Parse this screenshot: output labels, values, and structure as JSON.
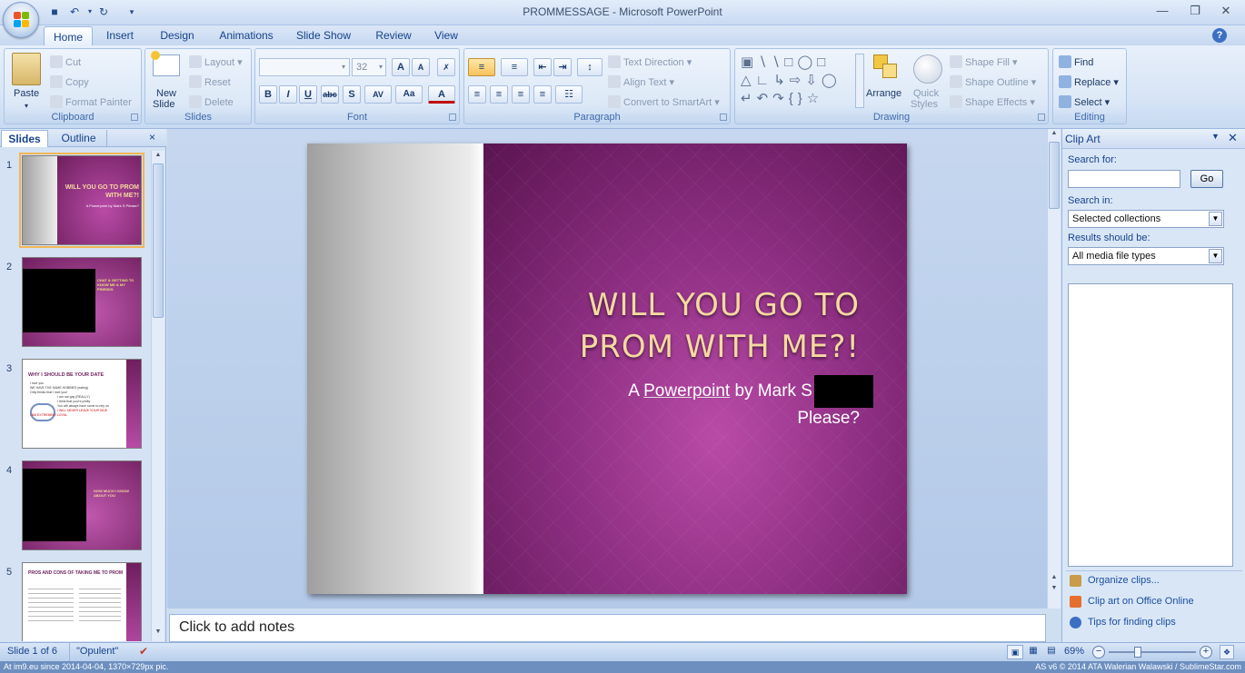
{
  "window": {
    "title": "PROMMESSAGE - Microsoft PowerPoint"
  },
  "tabs": [
    "Home",
    "Insert",
    "Design",
    "Animations",
    "Slide Show",
    "Review",
    "View"
  ],
  "ribbon": {
    "clipboard": {
      "label": "Clipboard",
      "paste": "Paste",
      "cut": "Cut",
      "copy": "Copy",
      "format_painter": "Format Painter"
    },
    "slides": {
      "label": "Slides",
      "new_slide_1": "New",
      "new_slide_2": "Slide",
      "layout": "Layout",
      "reset": "Reset",
      "delete": "Delete"
    },
    "font": {
      "label": "Font",
      "size": "32"
    },
    "paragraph": {
      "label": "Paragraph",
      "text_direction": "Text Direction",
      "align_text": "Align Text",
      "convert": "Convert to SmartArt"
    },
    "drawing": {
      "label": "Drawing",
      "arrange": "Arrange",
      "quick_styles_1": "Quick",
      "quick_styles_2": "Styles",
      "shape_fill": "Shape Fill",
      "shape_outline": "Shape Outline",
      "shape_effects": "Shape Effects"
    },
    "editing": {
      "label": "Editing",
      "find": "Find",
      "replace": "Replace",
      "select": "Select"
    }
  },
  "left_pane": {
    "tabs": [
      "Slides",
      "Outline"
    ],
    "slides": [
      {
        "num": "1",
        "title": "WILL YOU GO TO PROM WITH ME?!",
        "sub": "A Powerpoint by Mark S Please?"
      },
      {
        "num": "2",
        "title": "CHAT & GETTING TO KNOW ME & MY FRIENDS"
      },
      {
        "num": "3",
        "title": "WHY I SHOULD BE YOUR DATE",
        "lines": [
          "I love you",
          "WE HAVE THE SAME HOBBIES (eating)",
          "Only thinks that I love you!",
          "I am not gay (REALLY)",
          "I think that you're pretty",
          "You will always have some to rely on",
          "I WILL NEVER LEAVE YOUR SIDE",
          "I AM EXTREMELY LOYAL"
        ]
      },
      {
        "num": "4",
        "title": "HOW MUCH I KNOW ABOUT YOU"
      },
      {
        "num": "5",
        "title": "PROS AND CONS OF TAKING ME TO PROM"
      }
    ]
  },
  "slide": {
    "title_line1": "WILL YOU GO TO",
    "title_line2": "PROM WITH ME?!",
    "sub_prefix": "A ",
    "sub_link": "Powerpoint",
    "sub_suffix": " by Mark S",
    "sub_line2": "Please?"
  },
  "notes_placeholder": "Click to add notes",
  "clip_art": {
    "title": "Clip Art",
    "search_for_label": "Search for:",
    "search_value": "",
    "go": "Go",
    "search_in_label": "Search in:",
    "search_in_value": "Selected collections",
    "results_label": "Results should be:",
    "results_value": "All media file types",
    "links": [
      "Organize clips...",
      "Clip art on Office Online",
      "Tips for finding clips"
    ]
  },
  "status": {
    "slide_info": "Slide 1 of 6",
    "theme": "\"Opulent\"",
    "zoom": "69%"
  },
  "watermark": {
    "left": "At im9.eu  since 2014-04-04, 1370×729px pic.",
    "right": "AS v6 © 2014 ATA Walerian Walawski / SublimeStar.com"
  },
  "colors": {
    "ribbon": "#dbe7f7",
    "slide_purple": "#8e2f83",
    "title_gold": "#f5d9a0",
    "accent_link": "#1a4ea0"
  }
}
